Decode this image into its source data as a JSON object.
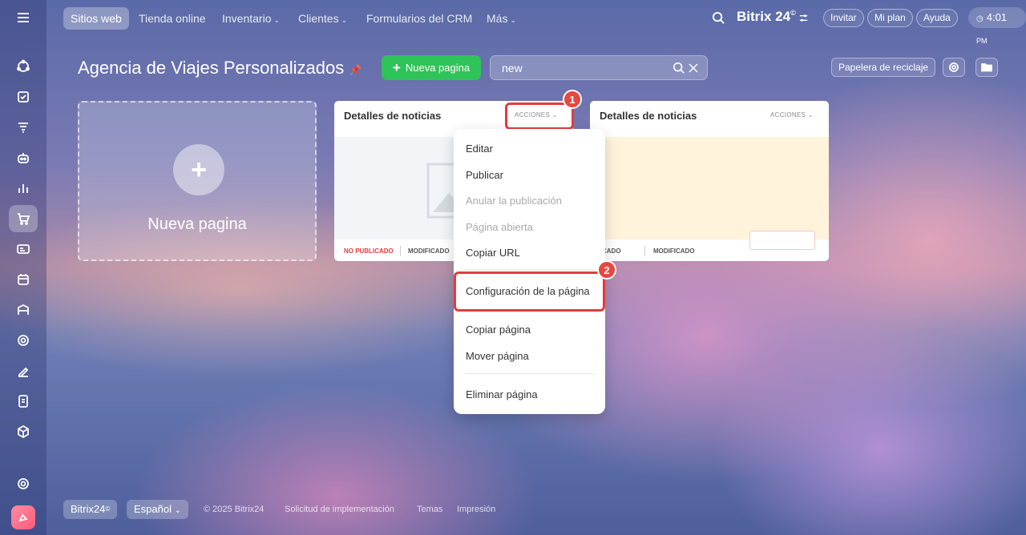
{
  "nav_tabs": [
    {
      "label": "Sitios web",
      "dropdown": false
    },
    {
      "label": "Tienda online",
      "dropdown": false
    },
    {
      "label": "Inventario",
      "dropdown": true
    },
    {
      "label": "Clientes",
      "dropdown": true
    },
    {
      "label": "Formularios del CRM",
      "dropdown": false
    },
    {
      "label": "Más",
      "dropdown": true
    }
  ],
  "brand": {
    "name": "Bitrix 24",
    "sup": "©"
  },
  "header_buttons": {
    "invite": "Invitar",
    "plan": "Mi plan",
    "help": "Ayuda"
  },
  "clock": {
    "time": "4:01",
    "ampm": "PM"
  },
  "page": {
    "title": "Agencia de Viajes Personalizados",
    "new_page_button": "Nueva pagina",
    "search_value": "new",
    "recycle_bin": "Papelera de reciclaje"
  },
  "new_page_card": {
    "label": "Nueva pagina"
  },
  "cards": [
    {
      "title": "Detalles de noticias",
      "actions": "ACCIONES",
      "status": "NO PUBLICADO",
      "modified": "MODIFICADO"
    },
    {
      "title": "Detalles de noticias",
      "actions": "ACCIONES",
      "status": "PUBLICADO",
      "modified": "MODIFICADO"
    }
  ],
  "actions_menu": {
    "items": [
      {
        "label": "Editar",
        "enabled": true
      },
      {
        "label": "Publicar",
        "enabled": true
      },
      {
        "label": "Anular la publicación",
        "enabled": false
      },
      {
        "label": "Página abierta",
        "enabled": false
      },
      {
        "label": "Copiar URL",
        "enabled": true
      },
      {
        "label": "Configuración de la página",
        "enabled": true
      },
      {
        "label": "Copiar página",
        "enabled": true
      },
      {
        "label": "Mover página",
        "enabled": true
      },
      {
        "label": "Eliminar página",
        "enabled": true
      }
    ]
  },
  "step_badges": [
    "1",
    "2"
  ],
  "footer": {
    "brand": "Bitrix24",
    "brand_sup": "©",
    "language": "Español",
    "copyright": "© 2025 Bitrix24",
    "links": [
      "Solicitud de implementación",
      "Temas",
      "Impresión"
    ]
  },
  "sidebar_icons": [
    "menu-icon",
    "activity-stream-icon",
    "tasks-icon",
    "crm-icon",
    "copilot-icon",
    "analytics-icon",
    "store-icon",
    "contact-center-icon",
    "calendar-icon",
    "company-icon",
    "goals-icon",
    "sign-icon",
    "forms-icon",
    "inventory-icon",
    "settings-icon",
    "app-icon"
  ],
  "colors": {
    "accent_green": "#2fc45a",
    "highlight_red": "#e23d3d",
    "not_published_red": "#e0413b"
  }
}
